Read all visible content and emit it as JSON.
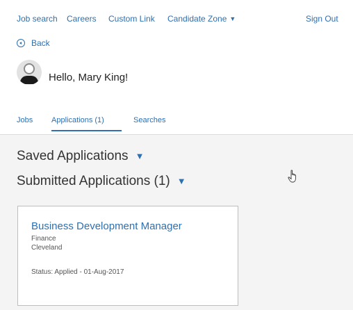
{
  "topnav": {
    "items": [
      {
        "label": "Job search"
      },
      {
        "label": "Careers"
      },
      {
        "label": "Custom Link"
      },
      {
        "label": "Candidate Zone"
      },
      {
        "label": "Sign Out"
      }
    ]
  },
  "back": {
    "label": "Back"
  },
  "greeting": {
    "text": "Hello, Mary King!"
  },
  "tabs": [
    {
      "label": "Jobs"
    },
    {
      "label": "Applications (1)"
    },
    {
      "label": "Searches"
    }
  ],
  "sections": {
    "saved": {
      "title": "Saved Applications"
    },
    "submitted": {
      "title": "Submitted Applications (1)"
    }
  },
  "application": {
    "title": "Business Development Manager",
    "department": "Finance",
    "location": "Cleveland",
    "status": "Status: Applied - 01-Aug-2017"
  },
  "colors": {
    "link": "#2e6fb0",
    "main_bg": "#f4f4f4"
  }
}
